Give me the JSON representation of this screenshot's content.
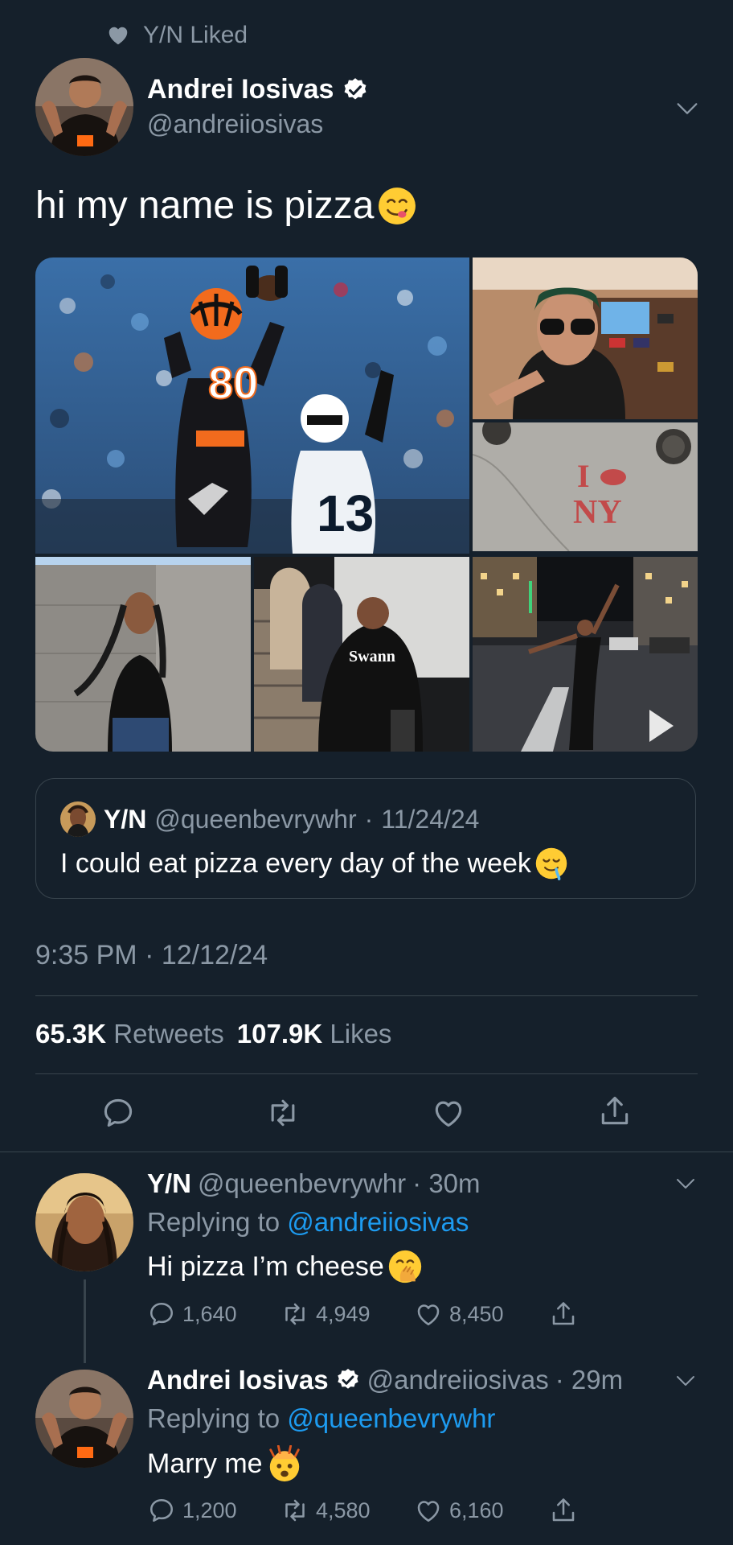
{
  "liked_line": {
    "text": "Y/N Liked"
  },
  "tweet": {
    "author_name": "Andrei Iosivas",
    "handle": "@andreiiosivas",
    "text": "hi my name is pizza",
    "timestamp": "9:35 PM · 12/12/24",
    "retweets": "65.3K",
    "retweets_label": "Retweets",
    "likes": "107.9K",
    "likes_label": "Likes"
  },
  "quote": {
    "name": "Y/N",
    "handle": "@queenbevrywhr",
    "separator": "·",
    "date": "11/24/24",
    "text": "I could eat pizza every day of the week"
  },
  "media": {
    "jersey_main": "80",
    "jersey_defender": "13",
    "sign_text_1": "I",
    "sign_text_2": "NY",
    "hoodie_text": "Swann"
  },
  "replies": [
    {
      "name": "Y/N",
      "handle": "@queenbevrywhr",
      "time": "· 30m",
      "replying_prefix": "Replying to",
      "replying_to": "@andreiiosivas",
      "text": "Hi pizza I’m cheese",
      "replies": "1,640",
      "retweets": "4,949",
      "likes": "8,450"
    },
    {
      "name": "Andrei Iosivas",
      "handle": "@andreiiosivas",
      "time": "· 29m",
      "replying_prefix": "Replying to",
      "replying_to": "@queenbevrywhr",
      "text": "Marry me",
      "replies": "1,200",
      "retweets": "4,580",
      "likes": "6,160"
    }
  ],
  "colors": {
    "background": "#15202b",
    "muted": "#8b98a5",
    "link": "#1d9bf0",
    "border": "#38444d"
  },
  "icons": [
    "heart-icon",
    "verified-badge-icon",
    "chevron-down-icon",
    "reply-icon",
    "retweet-icon",
    "like-icon",
    "share-icon",
    "emoji-yum-icon",
    "emoji-drool-icon",
    "emoji-hand-over-mouth-icon",
    "emoji-mind-blown-icon"
  ]
}
